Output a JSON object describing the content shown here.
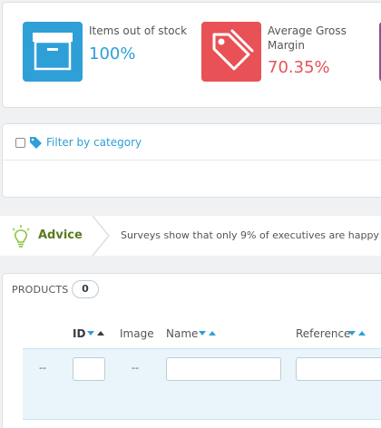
{
  "kpis": [
    {
      "title": "Items out of stock",
      "value": "100%",
      "icon": "archive-box-icon",
      "color": "#2f9fd7"
    },
    {
      "title": "Average Gross Margin",
      "value": "70.35%",
      "icon": "price-tag-icon",
      "color": "#e85156"
    },
    {
      "title": "",
      "value": "",
      "icon": "",
      "color": "#8a5193"
    }
  ],
  "filter": {
    "label": "Filter by category",
    "checked": false,
    "icon": "tag-icon"
  },
  "advice": {
    "title": "Advice",
    "text": "Surveys show that only 9% of executives are happy w",
    "icon": "lightbulb-icon"
  },
  "products": {
    "title": "PRODUCTS",
    "count": "0",
    "columns": [
      {
        "label": "ID",
        "sortable": true
      },
      {
        "label": "Image",
        "sortable": false
      },
      {
        "label": "Name",
        "sortable": true
      },
      {
        "label": "Reference",
        "sortable": true
      }
    ],
    "filter_row": {
      "bulk_placeholder": "--",
      "image_placeholder": "--",
      "id_value": "",
      "name_value": "",
      "reference_value": ""
    }
  },
  "colors": {
    "accent": "#2f9fd7",
    "danger": "#e85156",
    "advice_green": "#5b7a1f",
    "purple": "#8a5193"
  }
}
